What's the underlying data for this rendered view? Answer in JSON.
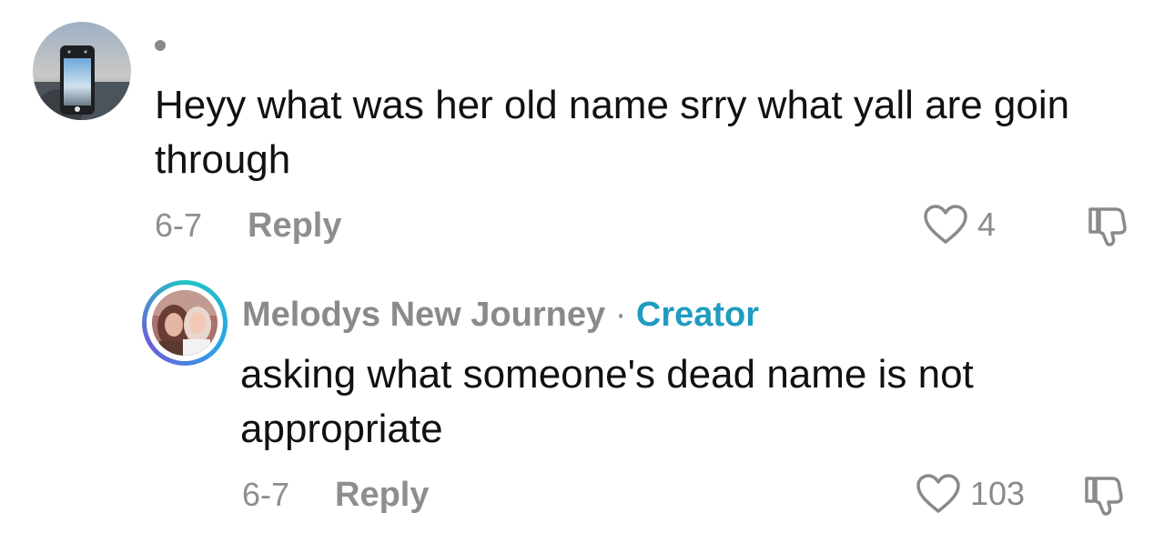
{
  "comment": {
    "text": "Heyy what was her old name srry what yall are goin through",
    "date": "6-7",
    "reply_label": "Reply",
    "like_count": "4"
  },
  "reply": {
    "username": "Melodys New Journey",
    "separator": "·",
    "badge": "Creator",
    "text": "asking what someone's dead name is not appropriate",
    "date": "6-7",
    "reply_label": "Reply",
    "like_count": "103"
  },
  "colors": {
    "creator_accent": "#1f9cc0",
    "meta_gray": "#8e8e8e",
    "text": "#111111"
  },
  "icons": {
    "like": "heart-outline-icon",
    "dislike": "thumbs-down-icon"
  }
}
